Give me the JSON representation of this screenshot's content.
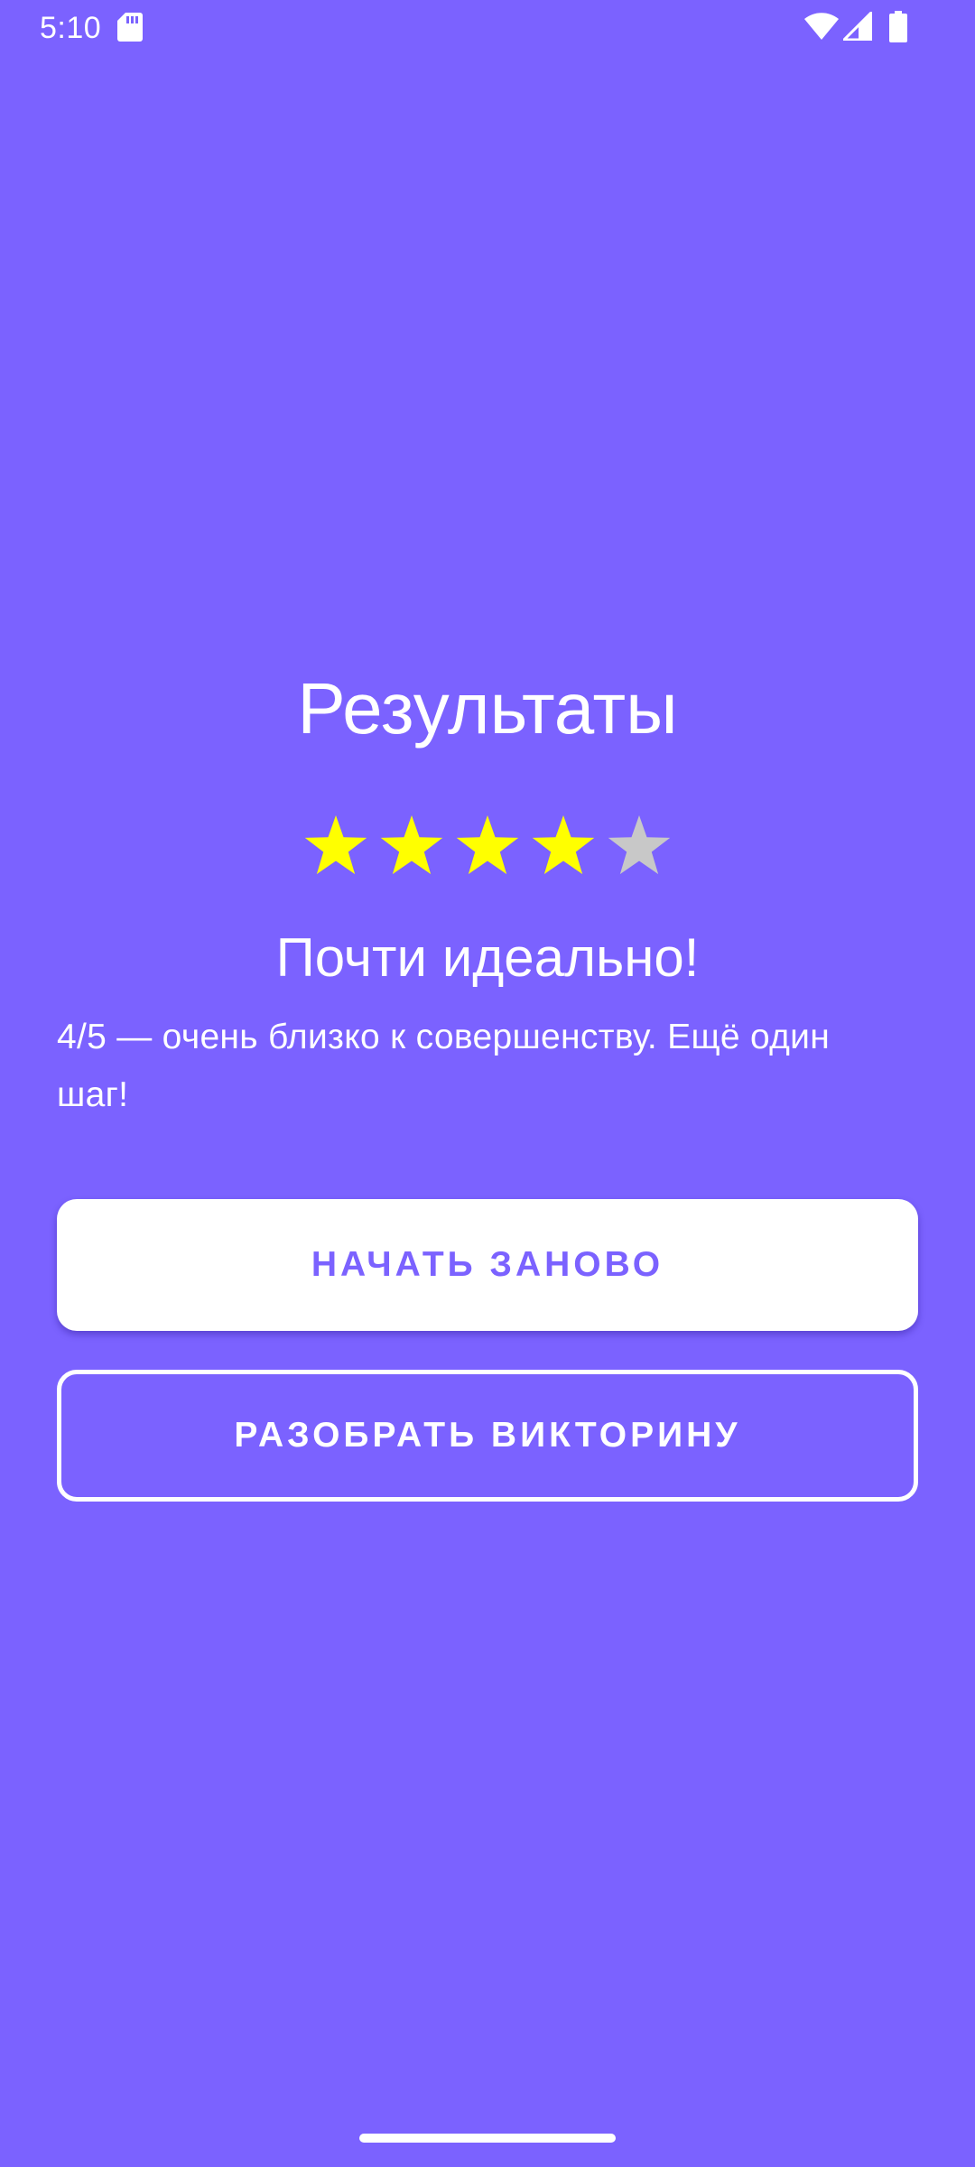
{
  "status_bar": {
    "time": "5:10",
    "icons": [
      "sd-card-icon",
      "wifi-icon",
      "signal-icon",
      "battery-icon"
    ]
  },
  "results": {
    "title": "Результаты",
    "rating": {
      "value": 4,
      "max": 5
    },
    "subtitle": "Почти идеально!",
    "message": "4/5 — очень близко к совершенству. Ещё один шаг!"
  },
  "buttons": {
    "restart_label": "НАЧАТЬ ЗАНОВО",
    "review_label": "РАЗОБРАТЬ ВИКТОРИНУ"
  },
  "colors": {
    "background": "#7b62ff",
    "star_filled": "#ffff00",
    "star_empty": "#c8c8c8",
    "text": "#ffffff",
    "accent": "#7b62ff"
  }
}
